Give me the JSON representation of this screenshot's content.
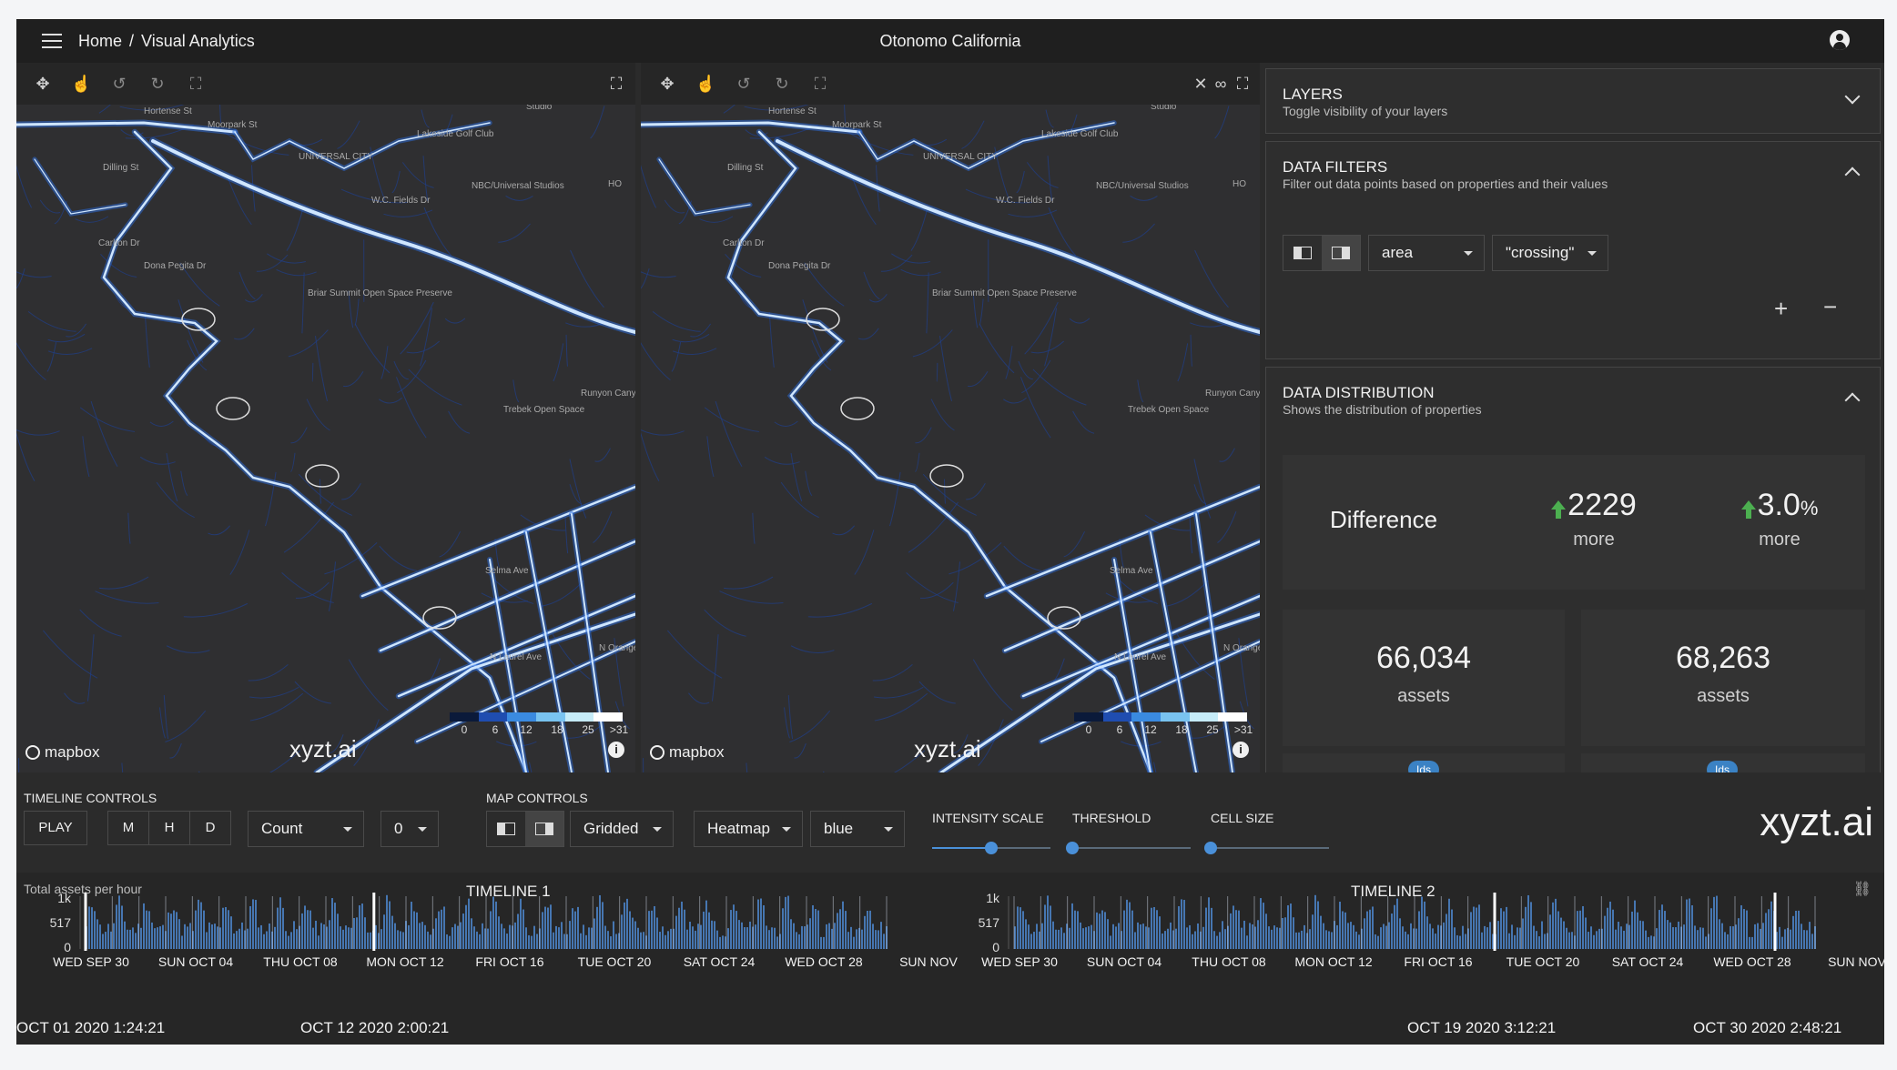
{
  "topbar": {
    "breadcrumb_home": "Home",
    "breadcrumb_sep": "/",
    "breadcrumb_current": "Visual Analytics",
    "title": "Otonomo California"
  },
  "map": {
    "attribution": "mapbox",
    "watermark": "xyzt.ai",
    "info_glyph": "i",
    "legend_labels": [
      "0",
      "6",
      "12",
      "18",
      "25",
      ">31"
    ],
    "legend_colors": [
      "#0b1a3a",
      "#1f4db0",
      "#3a8ae0",
      "#79c3f0",
      "#c6ecf8",
      "#ffffff"
    ],
    "labels": [
      "UNIVERSAL CITY",
      "Lakeside Golf Club",
      "NBC/Universal Studios",
      "Briar Summit Open Space Preserve",
      "Runyon Canyon Park",
      "Trebek Open Space",
      "Hortense St",
      "Moorpark St",
      "Dilling St",
      "Carlton Dr",
      "Dona Pegita Dr",
      "W.C. Fields Dr",
      "Studio",
      "HO",
      "Selma Ave",
      "N Orange Dr",
      "N Laurel Ave"
    ],
    "left_tools": [
      "move-tool-icon",
      "select-tool-icon",
      "rotate-left-icon",
      "rotate-right-icon",
      "reset-view-icon"
    ],
    "right_tools": [
      "move-tool-icon",
      "select-tool-icon",
      "rotate-left-icon",
      "rotate-right-icon",
      "reset-view-icon"
    ],
    "fullscreen_icon": "fullscreen-icon",
    "close_icon": "close-icon",
    "link_icon": "link-icon"
  },
  "layers": {
    "title": "LAYERS",
    "subtitle": "Toggle visibility of your layers"
  },
  "filters": {
    "title": "DATA FILTERS",
    "subtitle": "Filter out data points based on properties and their values",
    "property": "area",
    "value": "\"crossing\"",
    "add": "+",
    "remove": "−"
  },
  "distribution": {
    "title": "DATA DISTRIBUTION",
    "subtitle": "Shows the distribution of properties",
    "difference_label": "Difference",
    "diff_count": "2229",
    "diff_count_label": "more",
    "diff_pct": "3.0",
    "diff_pct_unit": "%",
    "diff_pct_label": "more",
    "left_total": "66,034",
    "left_total_label": "assets",
    "right_total": "68,263",
    "right_total_label": "assets",
    "ids_label": "Ids",
    "up_color": "#4caf50"
  },
  "timeline_controls": {
    "title": "TIMELINE CONTROLS",
    "play": "PLAY",
    "m": "M",
    "h": "H",
    "d": "D",
    "metric": "Count",
    "offset": "0"
  },
  "map_controls": {
    "title": "MAP CONTROLS",
    "grid": "Gridded",
    "vis": "Heatmap",
    "color": "blue",
    "intensity": "INTENSITY SCALE",
    "threshold": "THRESHOLD",
    "cell": "CELL SIZE",
    "intensity_value": 0.5,
    "threshold_value": 0.0,
    "cell_value": 0.0
  },
  "brand": "xyzt.ai",
  "timelines": {
    "ylabel": "Total assets per hour",
    "t1_title": "TIMELINE 1",
    "t2_title": "TIMELINE 2",
    "y_ticks": [
      "1k",
      "517",
      "0"
    ],
    "x_ticks": [
      "WED SEP 30",
      "SUN OCT 04",
      "THU OCT 08",
      "MON OCT 12",
      "FRI OCT 16",
      "TUE OCT 20",
      "SAT OCT 24",
      "WED OCT 28",
      "SUN NOV"
    ],
    "ts1": "OCT 01 2020 1:24:21",
    "ts2": "OCT 12 2020 2:00:21",
    "ts3": "OCT 19 2020 3:12:21",
    "ts4": "OCT 30 2020 2:48:21",
    "unlink_icon": "unlink-icon",
    "bar_color": "#4a7fc1"
  }
}
